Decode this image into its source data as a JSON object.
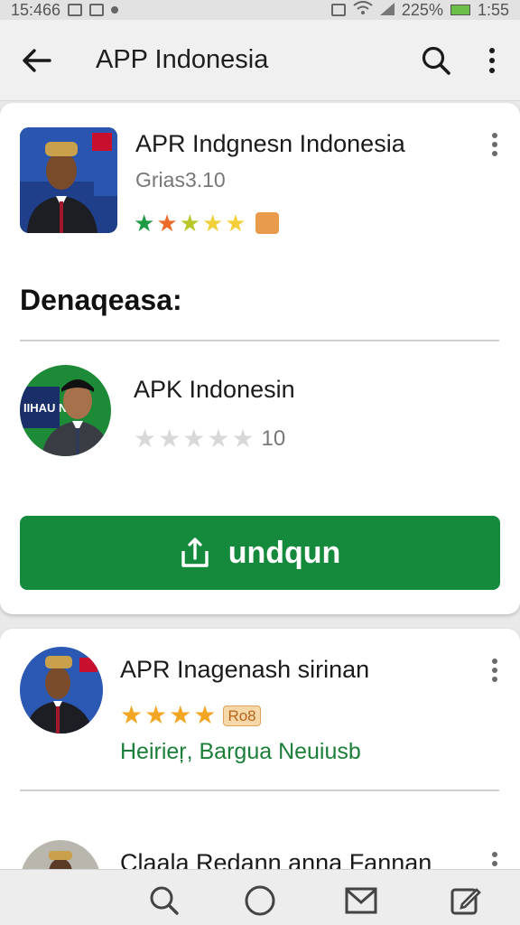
{
  "status_bar": {
    "time_left": "15:466",
    "battery": "225%",
    "time_right": "1:55"
  },
  "app_bar": {
    "title": "APP Indonesia"
  },
  "featured": {
    "title": "APR Indgnesn Indonesia",
    "subtitle": "Grias3.10",
    "rating_stars": 5,
    "star_colors": [
      "#1f9a45",
      "#ec6a2a",
      "#b8c72a",
      "#f0d03a",
      "#f5cf3a"
    ],
    "badge_color": "#e89b4a"
  },
  "section": {
    "title": "Denaqeasa:"
  },
  "detail": {
    "title": "APK Indonesin",
    "rating_count": "10",
    "rating_stars": 0,
    "thumb_caption": "IIHAU NIWA"
  },
  "download_button": {
    "label": "undqun"
  },
  "list": [
    {
      "title": "APR Inagenash sirinan",
      "rating_stars": 4,
      "badge": "Ro8",
      "link": "Heirieŗ, Bargua Neuiusb"
    },
    {
      "title": "Claala Redann anna Fannan"
    }
  ],
  "colors": {
    "accent_green": "#168a3c",
    "star_gold": "#f2a623",
    "star_empty": "#d8d8d8"
  }
}
